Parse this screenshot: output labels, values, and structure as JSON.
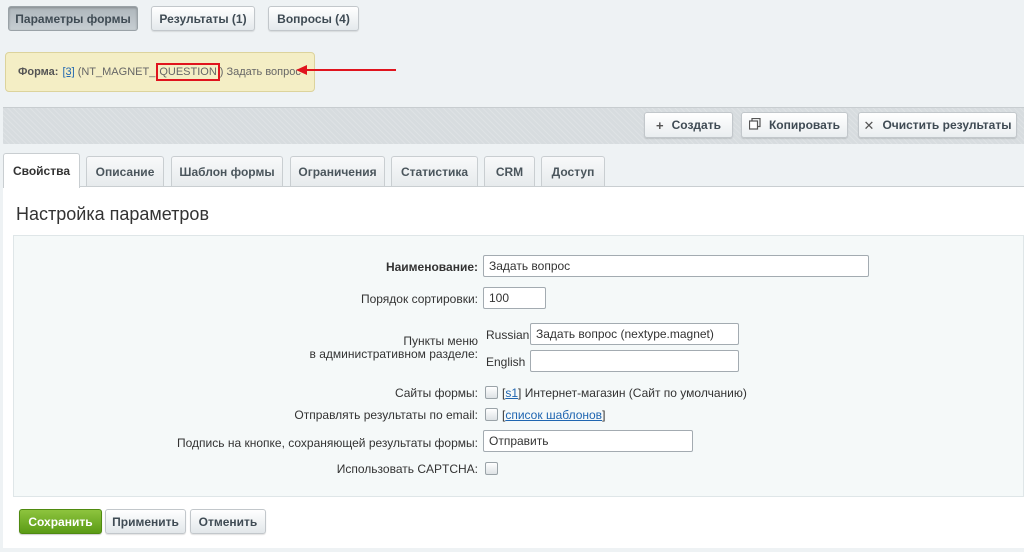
{
  "top_tabs": [
    {
      "label": "Параметры формы",
      "active": true
    },
    {
      "label": "Результаты (1)",
      "active": false
    },
    {
      "label": "Вопросы (4)",
      "active": false
    }
  ],
  "notice": {
    "prefix": "Форма:",
    "link": "[3]",
    "code_a": "(NT_MAGNET_",
    "code_b": "QUESTION",
    "code_c": ")",
    "name": "Задать вопрос",
    "highlight_color": "#e0141d"
  },
  "toolbar": {
    "create": "Создать",
    "copy": "Копировать",
    "clear": "Очистить результаты"
  },
  "tabs": [
    {
      "label": "Свойства",
      "active": true
    },
    {
      "label": "Описание",
      "active": false
    },
    {
      "label": "Шаблон формы",
      "active": false
    },
    {
      "label": "Ограничения",
      "active": false
    },
    {
      "label": "Статистика",
      "active": false
    },
    {
      "label": "CRM",
      "active": false
    },
    {
      "label": "Доступ",
      "active": false
    }
  ],
  "section_title": "Настройка параметров",
  "form": {
    "name_label": "Наименование:",
    "name_value": "Задать вопрос",
    "sort_label": "Порядок сортировки:",
    "sort_value": "100",
    "menu_label_1": "Пункты меню",
    "menu_label_2": "в административном разделе:",
    "lang_russian": "Russian",
    "menu_russian_value": "Задать вопрос (nextype.magnet)",
    "lang_english": "English",
    "menu_english_value": "",
    "sites_label": "Сайты формы:",
    "site_link": "s1",
    "site_name": "Интернет-магазин (Сайт по умолчанию)",
    "email_label": "Отправлять результаты по email:",
    "email_link": "список шаблонов",
    "button_caption_label": "Подпись на кнопке, сохраняющей результаты формы:",
    "button_caption_value": "Отправить",
    "captcha_label": "Использовать CAPTCHA:"
  },
  "actions": {
    "save": "Сохранить",
    "apply": "Применить",
    "cancel": "Отменить"
  },
  "colors": {
    "accent_green": "#6aab22",
    "link_blue": "#2066b1",
    "notice_bg": "#f4eec5"
  }
}
